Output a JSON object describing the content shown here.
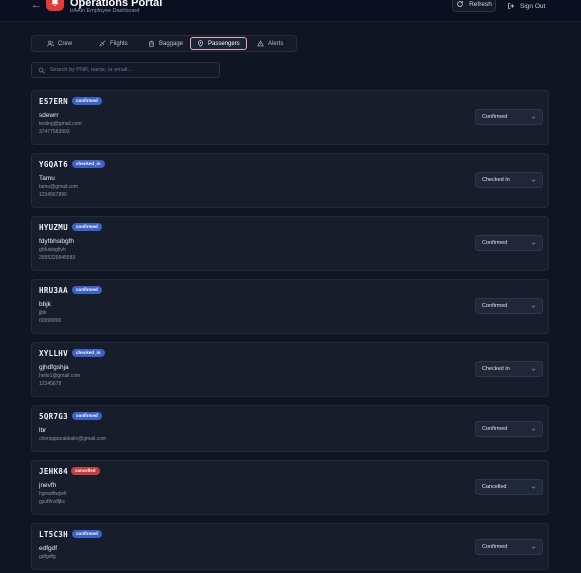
{
  "header": {
    "back_icon": "arrow-left-icon",
    "logo_icon": "bell-icon",
    "title": "Operations Portal",
    "subtitle": "trAAin Employee Dashboard",
    "refresh_label": "Refresh",
    "signout_label": "Sign Out",
    "accent": "#e23a3a"
  },
  "tabs": [
    {
      "label": "Crew",
      "icon": "users-icon",
      "active": false
    },
    {
      "label": "Flights",
      "icon": "plane-icon",
      "active": false
    },
    {
      "label": "Baggage",
      "icon": "luggage-icon",
      "active": false
    },
    {
      "label": "Passengers",
      "icon": "map-pin-icon",
      "active": true
    },
    {
      "label": "Alerts",
      "icon": "warning-icon",
      "active": false
    }
  ],
  "search": {
    "placeholder": "Search by PNR, name, or email..."
  },
  "passengers": [
    {
      "pnr": "ES7ERN",
      "badge": "confirmed",
      "name": "sdewrr",
      "line1": "testing@gmail.com",
      "line2": "37477583993",
      "status": "Confirmed"
    },
    {
      "pnr": "YGQAT6",
      "badge": "checked_in",
      "name": "Tamu",
      "line1": "tamu@gmail.com",
      "line2": "1234567890",
      "status": "Checked In"
    },
    {
      "pnr": "HYUZMU",
      "badge": "confirmed",
      "name": "fdyfbhsibgfh",
      "line1": "ghfuidsgfiyh",
      "line2": "2655326845683",
      "status": "Confirmed"
    },
    {
      "pnr": "HRU3AA",
      "badge": "confirmed",
      "name": "bbjk",
      "line1": "jjbk",
      "line2": "00999090",
      "status": "Confirmed"
    },
    {
      "pnr": "XYLLHV",
      "badge": "checked_in",
      "name": "gjhdfgshja",
      "line1": "hello1@gmail.com",
      "line2": "12345678",
      "status": "Checked In"
    },
    {
      "pnr": "5QR7G3",
      "badge": "confirmed",
      "name": "lbr",
      "line1": "cherippparakkalin@gmail.com",
      "line2": "",
      "status": "Confirmed"
    },
    {
      "pnr": "JEHK84",
      "badge": "cancelled",
      "name": "jnevfh",
      "line1": "hgrwdhwjwh",
      "line2": "gyufihvdfjkc",
      "status": "Cancelled"
    },
    {
      "pnr": "LT5C3H",
      "badge": "confirmed",
      "name": "edfgdf",
      "line1": "gdfgdfg",
      "line2": "",
      "status": "Confirmed"
    }
  ]
}
